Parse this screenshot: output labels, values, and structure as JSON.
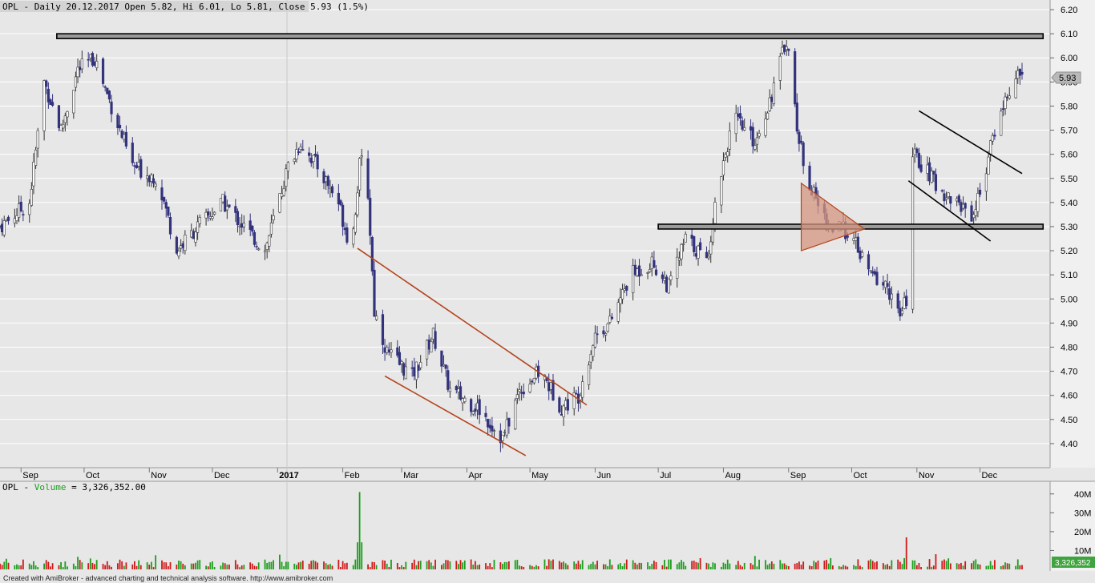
{
  "header": {
    "price_title": "OPL - Daily 20.12.2017 Open 5.82, Hi 6.01, Lo 5.81, Close 5.93 (1.5%)",
    "volume_prefix": "OPL - ",
    "volume_label": "Volume",
    "volume_value": " = 3,326,352.00"
  },
  "footer": {
    "text": "Created with AmiBroker - advanced charting and technical analysis software. http://www.amibroker.com"
  },
  "colors": {
    "background": "#e7e7e7",
    "grid": "#ffffff",
    "up_candle": "#ffffff",
    "down_candle": "#33337d",
    "volume_up": "#1c9e1c",
    "volume_down": "#d01818",
    "trendline": "#b4441c",
    "triangle_fill": "#d4957f",
    "last_price_box": "#b9b9b9",
    "volume_last_box": "#3fa33f"
  },
  "price_axis": {
    "ticks": [
      "6.20",
      "6.10",
      "6.00",
      "5.90",
      "5.80",
      "5.70",
      "5.60",
      "5.50",
      "5.40",
      "5.30",
      "5.20",
      "5.10",
      "5.00",
      "4.90",
      "4.80",
      "4.70",
      "4.60",
      "4.50",
      "4.40"
    ],
    "last_price": "5.93"
  },
  "volume_axis": {
    "ticks": [
      "40M",
      "30M",
      "20M",
      "10M"
    ],
    "last_value": "3,326,352"
  },
  "chart_data": {
    "type": "candlestick",
    "symbol": "OPL",
    "ylim": [
      4.3,
      6.24
    ],
    "x_axis_labels": [
      "Sep",
      "Oct",
      "Nov",
      "Dec",
      "2017",
      "Feb",
      "Mar",
      "Apr",
      "May",
      "Jun",
      "Jul",
      "Aug",
      "Sep",
      "Oct",
      "Nov",
      "Dec"
    ],
    "price_path": {
      "dates": [
        "2016-08-22",
        "2016-09-05",
        "2016-09-12",
        "2016-09-20",
        "2016-09-28",
        "2016-10-06",
        "2016-10-14",
        "2016-10-24",
        "2016-11-05",
        "2016-11-14",
        "2016-11-24",
        "2016-12-06",
        "2016-12-16",
        "2016-12-26",
        "2017-01-06",
        "2017-01-12",
        "2017-01-20",
        "2017-01-30",
        "2017-02-05",
        "2017-02-09",
        "2017-02-12",
        "2017-02-16",
        "2017-02-22",
        "2017-03-06",
        "2017-03-16",
        "2017-03-24",
        "2017-04-06",
        "2017-04-18",
        "2017-04-26",
        "2017-05-06",
        "2017-05-16",
        "2017-05-24",
        "2017-06-01",
        "2017-06-08",
        "2017-06-18",
        "2017-06-28",
        "2017-07-06",
        "2017-07-14",
        "2017-07-20",
        "2017-07-24",
        "2017-07-30",
        "2017-08-06",
        "2017-08-16",
        "2017-08-24",
        "2017-08-31",
        "2017-09-02",
        "2017-09-06",
        "2017-09-12",
        "2017-09-20",
        "2017-09-30",
        "2017-10-04",
        "2017-10-10",
        "2017-10-18",
        "2017-10-24",
        "2017-10-27",
        "2017-10-30",
        "2017-11-04",
        "2017-11-12",
        "2017-11-20",
        "2017-11-28",
        "2017-12-04",
        "2017-12-08",
        "2017-12-14",
        "2017-12-20"
      ],
      "closes": [
        5.3,
        5.4,
        5.9,
        5.7,
        5.95,
        6.0,
        5.8,
        5.55,
        5.5,
        5.2,
        5.3,
        5.4,
        5.3,
        5.2,
        5.55,
        5.65,
        5.55,
        5.4,
        5.2,
        5.55,
        5.6,
        4.95,
        4.78,
        4.68,
        4.85,
        4.62,
        4.55,
        4.42,
        4.62,
        4.7,
        4.55,
        4.6,
        4.85,
        4.9,
        5.1,
        5.15,
        5.05,
        5.25,
        5.2,
        5.15,
        5.5,
        5.75,
        5.65,
        5.85,
        6.08,
        5.95,
        5.65,
        5.45,
        5.3,
        5.28,
        5.2,
        5.1,
        5.05,
        4.92,
        5.0,
        5.6,
        5.55,
        5.45,
        5.4,
        5.35,
        5.55,
        5.7,
        5.85,
        5.93
      ]
    },
    "volume_spikes": [
      {
        "date": "2017-02-09",
        "value": 41
      },
      {
        "date": "2017-10-27",
        "value": 17
      }
    ],
    "annotations": [
      {
        "type": "resistance",
        "level": 6.09,
        "from": "2016-09-18",
        "to": "2017-12-31"
      },
      {
        "type": "support",
        "level": 5.3,
        "from": "2017-07-01",
        "to": "2017-12-31"
      },
      {
        "type": "trendline",
        "color": "#b4441c",
        "from": [
          "2017-02-08",
          5.21
        ],
        "to": [
          "2017-05-28",
          4.56
        ]
      },
      {
        "type": "trendline",
        "color": "#b4441c",
        "from": [
          "2017-02-21",
          4.68
        ],
        "to": [
          "2017-04-29",
          4.35
        ]
      },
      {
        "type": "triangle",
        "points": [
          [
            "2017-09-07",
            5.48
          ],
          [
            "2017-09-07",
            5.2
          ],
          [
            "2017-10-07",
            5.29
          ]
        ]
      },
      {
        "type": "trendline",
        "color": "#000000",
        "from": [
          "2017-10-28",
          5.49
        ],
        "to": [
          "2017-12-06",
          5.24
        ]
      },
      {
        "type": "trendline",
        "color": "#000000",
        "from": [
          "2017-11-02",
          5.78
        ],
        "to": [
          "2017-12-21",
          5.52
        ]
      }
    ]
  }
}
